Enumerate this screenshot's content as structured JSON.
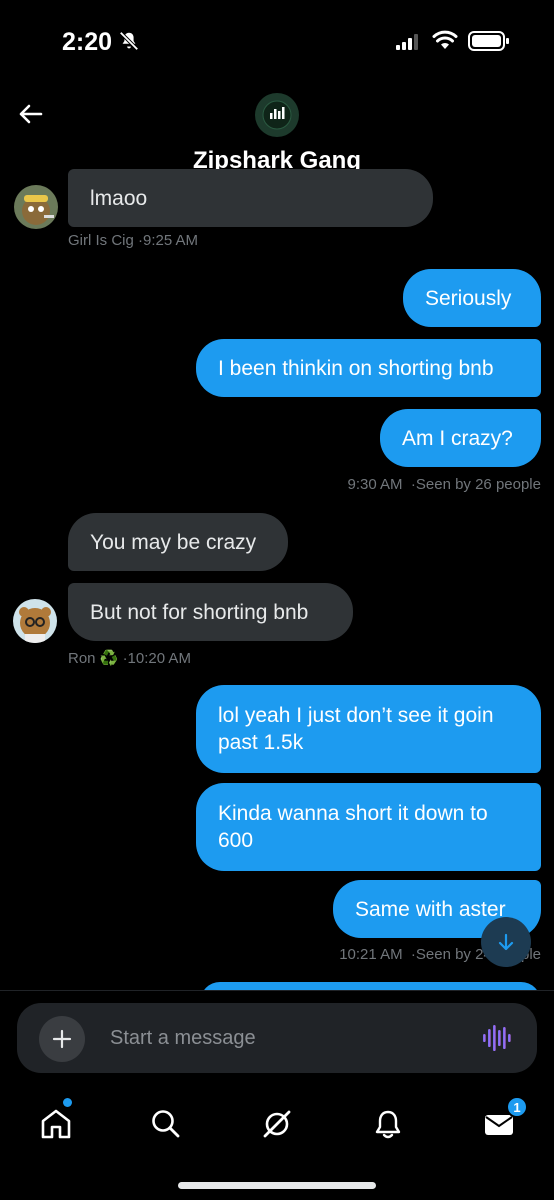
{
  "status_bar": {
    "time": "2:20"
  },
  "header": {
    "title": "Zipshark Gang",
    "avatar_label": "ZipCharts"
  },
  "messages": [
    {
      "text": "lmaoo"
    },
    {
      "text": "Seriously"
    },
    {
      "text": "I been thinkin on shorting bnb"
    },
    {
      "text": "Am I crazy?"
    },
    {
      "text": "You may be crazy"
    },
    {
      "text": "But not for shorting bnb"
    },
    {
      "line1": "lol yeah I just don’t see it goin",
      "line2": "past 1.5k"
    },
    {
      "line1": "Kinda wanna short it down to",
      "line2": "600"
    },
    {
      "text": "Same with aster"
    }
  ],
  "meta": {
    "m1_sender": "Girl Is Cig",
    "m1_time": "·9:25 AM",
    "m4": "9:30 AM  ·Seen by 26 people",
    "m6_sender": "Ron",
    "m6_emoji": "♻️",
    "m6_time": "·10:20 AM",
    "m9": "10:21 AM  ·Seen by 24 people"
  },
  "composer": {
    "placeholder": "Start a message"
  },
  "tabbar": {
    "messages_badge": "1"
  },
  "colors": {
    "accent": "#1d9bf0",
    "incoming_bubble": "#2f3336",
    "background": "#000000"
  }
}
